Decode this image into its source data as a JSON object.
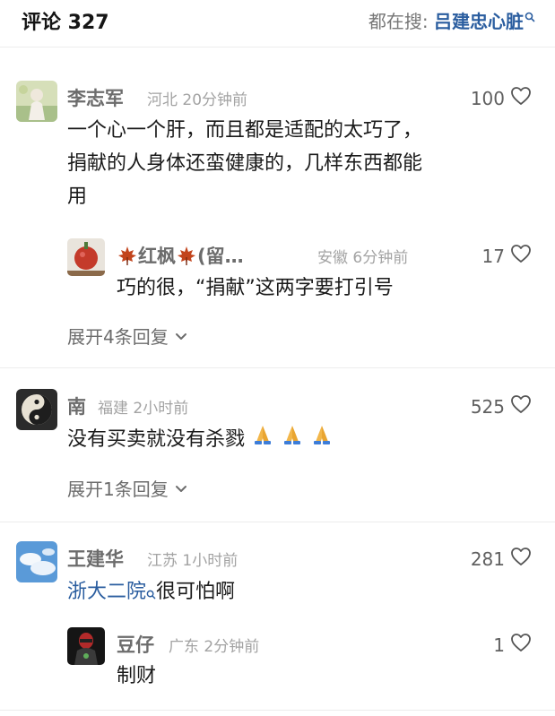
{
  "header": {
    "title": "评论 327",
    "search_prefix": "都在搜: ",
    "search_keyword": "吕建忠心脏"
  },
  "comments": [
    {
      "name": "李志军",
      "location": "河北",
      "time": "20分钟前",
      "likes": "100",
      "text_lines": [
        "一个心一个肝，而且都是适配的太巧了，",
        "捐献的人身体还蛮健康的，几样东西都能",
        "用"
      ],
      "replies": [
        {
          "name": "红枫",
          "name_suffix": "(留…",
          "location": "安徽",
          "time": "6分钟前",
          "likes": "17",
          "text": "巧的很，“捐献”这两字要打引号"
        }
      ],
      "expand_label": "展开4条回复"
    },
    {
      "name": "南",
      "location": "福建",
      "time": "2小时前",
      "likes": "525",
      "text": "没有买卖就没有杀戮",
      "emoji": [
        "praying-hands",
        "praying-hands",
        "praying-hands"
      ],
      "expand_label": "展开1条回复"
    },
    {
      "name": "王建华",
      "location": "江苏",
      "time": "1小时前",
      "likes": "281",
      "text_link": "浙大二院",
      "text_rest": "很可怕啊",
      "replies": [
        {
          "name": "豆仔",
          "location": "广东",
          "time": "2分钟前",
          "likes": "1",
          "text": "制财"
        }
      ]
    }
  ],
  "icons": {
    "like": "heart-outline-icon",
    "search": "search-icon",
    "expand": "chevron-down-icon"
  },
  "colors": {
    "link": "#2a5d9f",
    "username": "#6c6c6c",
    "meta": "#a3a3a3"
  }
}
